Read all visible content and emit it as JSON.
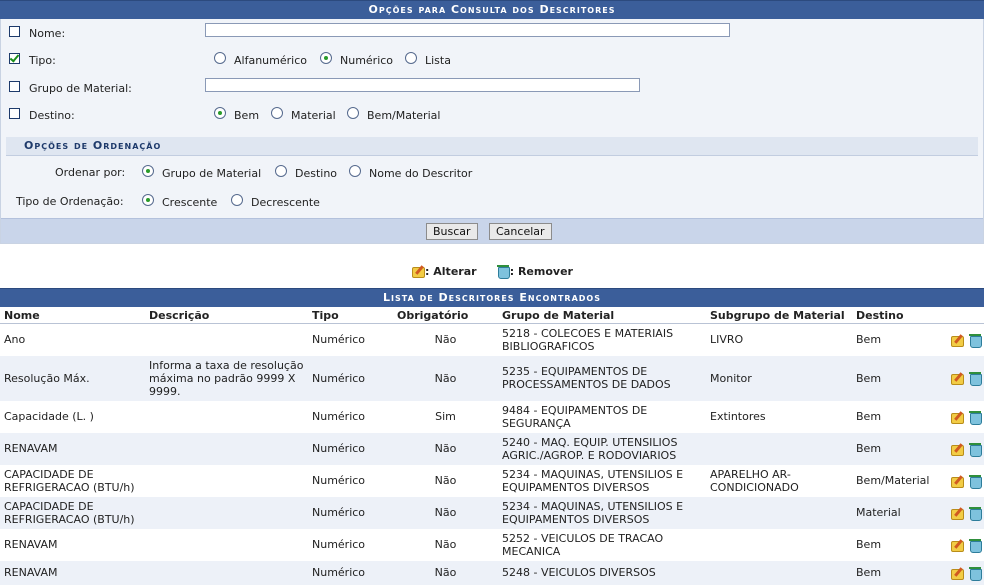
{
  "search_panel": {
    "title": "Opções para Consulta dos Descritores",
    "nome_label": "Nome:",
    "nome_value": "",
    "tipo_label": "Tipo:",
    "tipo_options": [
      "Alfanumérico",
      "Numérico",
      "Lista"
    ],
    "tipo_selected": "Numérico",
    "grupo_label": "Grupo de Material:",
    "grupo_value": "",
    "destino_label": "Destino:",
    "destino_options": [
      "Bem",
      "Material",
      "Bem/Material"
    ],
    "destino_selected": "Bem",
    "checked": {
      "nome": false,
      "tipo": true,
      "grupo": false,
      "destino": false
    }
  },
  "ordering": {
    "title": "Opções de Ordenação",
    "ordenar_label": "Ordenar por:",
    "ordenar_options": [
      "Grupo de Material",
      "Destino",
      "Nome do Descritor"
    ],
    "ordenar_selected": "Grupo de Material",
    "tipo_label": "Tipo de Ordenação:",
    "tipo_options": [
      "Crescente",
      "Decrescente"
    ],
    "tipo_selected": "Crescente"
  },
  "buttons": {
    "buscar": "Buscar",
    "cancelar": "Cancelar"
  },
  "legend": {
    "alterar": ": Alterar",
    "remover": ": Remover"
  },
  "results": {
    "title": "Lista de Descritores Encontrados",
    "columns": [
      "Nome",
      "Descrição",
      "Tipo",
      "Obrigatório",
      "Grupo de Material",
      "Subgrupo de Material",
      "Destino"
    ],
    "rows": [
      {
        "nome": "Ano",
        "descricao": "",
        "tipo": "Numérico",
        "obrigatorio": "Não",
        "grupo": "5218 - COLECOES E MATERIAIS BIBLIOGRAFICOS",
        "subgrupo": "LIVRO",
        "destino": "Bem"
      },
      {
        "nome": "Resolução Máx.",
        "descricao": "Informa a taxa de resolução máxima no padrão 9999 X 9999.",
        "tipo": "Numérico",
        "obrigatorio": "Não",
        "grupo": "5235 - EQUIPAMENTOS DE PROCESSAMENTOS DE DADOS",
        "subgrupo": "Monitor",
        "destino": "Bem"
      },
      {
        "nome": "Capacidade (L. )",
        "descricao": "",
        "tipo": "Numérico",
        "obrigatorio": "Sim",
        "grupo": "9484 - EQUIPAMENTOS DE SEGURANÇA",
        "subgrupo": "Extintores",
        "destino": "Bem"
      },
      {
        "nome": "RENAVAM",
        "descricao": "",
        "tipo": "Numérico",
        "obrigatorio": "Não",
        "grupo": "5240 - MAQ. EQUIP. UTENSILIOS AGRIC./AGROP. E RODOVIARIOS",
        "subgrupo": "",
        "destino": "Bem"
      },
      {
        "nome": "CAPACIDADE DE REFRIGERACAO (BTU/h)",
        "descricao": "",
        "tipo": "Numérico",
        "obrigatorio": "Não",
        "grupo": "5234 - MAQUINAS, UTENSILIOS E EQUIPAMENTOS DIVERSOS",
        "subgrupo": "APARELHO AR-CONDICIONADO",
        "destino": "Bem/Material"
      },
      {
        "nome": "CAPACIDADE DE REFRIGERACAO (BTU/h)",
        "descricao": "",
        "tipo": "Numérico",
        "obrigatorio": "Não",
        "grupo": "5234 - MAQUINAS, UTENSILIOS E EQUIPAMENTOS DIVERSOS",
        "subgrupo": "",
        "destino": "Material"
      },
      {
        "nome": "RENAVAM",
        "descricao": "",
        "tipo": "Numérico",
        "obrigatorio": "Não",
        "grupo": "5252 - VEICULOS DE TRACAO MECANICA",
        "subgrupo": "",
        "destino": "Bem"
      },
      {
        "nome": "RENAVAM",
        "descricao": "",
        "tipo": "Numérico",
        "obrigatorio": "Não",
        "grupo": "5248 - VEICULOS DIVERSOS",
        "subgrupo": "",
        "destino": "Bem"
      }
    ]
  },
  "colors": {
    "header_bg": "#3b5e9a",
    "row_alt": "#edf1f8",
    "button_bar": "#c9d5ea"
  }
}
